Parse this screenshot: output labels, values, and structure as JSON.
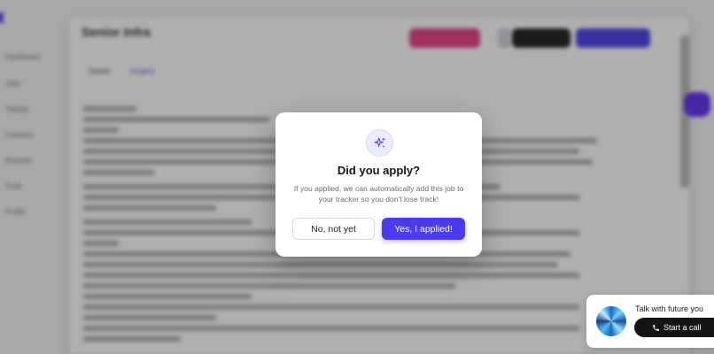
{
  "background": {
    "page_title": "Senior Infra",
    "sidebar_items": [
      "Dashboard",
      "Jobs",
      "Tracker",
      "Contacts",
      "Resume",
      "Tools",
      "Profile"
    ],
    "tabs": [
      "Details",
      "Insights"
    ]
  },
  "dialog": {
    "icon": "sparkles-icon",
    "title": "Did you apply?",
    "message": "If you applied, we can automatically add this job to your tracker so you don't lose track!",
    "secondary_label": "No, not yet",
    "primary_label": "Yes, I applied!"
  },
  "call_widget": {
    "title": "Talk with future you",
    "button_label": "Start a call",
    "button_icon": "phone-icon"
  },
  "colors": {
    "accent": "#4b3bef",
    "overlay": "rgba(45,45,48,0.38)"
  }
}
